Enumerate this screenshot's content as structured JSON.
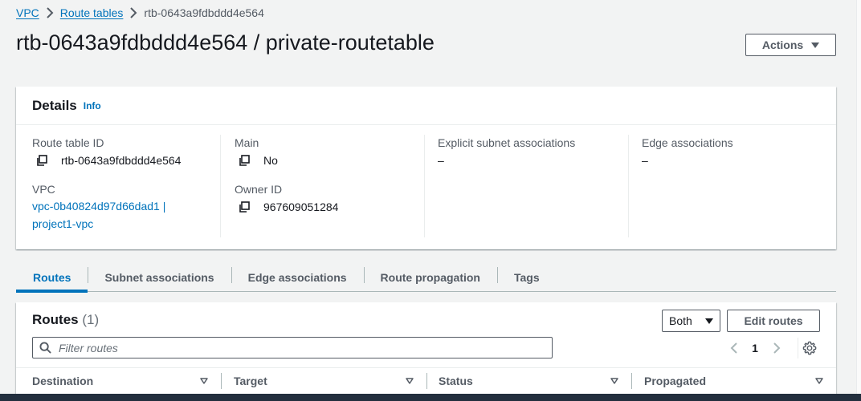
{
  "breadcrumb": {
    "items": [
      "VPC",
      "Route tables"
    ],
    "current": "rtb-0643a9fdbddd4e564"
  },
  "page": {
    "title": "rtb-0643a9fdbddd4e564 / private-routetable",
    "actions_label": "Actions"
  },
  "details": {
    "title": "Details",
    "info_label": "Info",
    "route_table_id_label": "Route table ID",
    "route_table_id_value": "rtb-0643a9fdbddd4e564",
    "vpc_label": "VPC",
    "vpc_value_line1": "vpc-0b40824d97d66dad1 |",
    "vpc_value_line2": "project1-vpc",
    "main_label": "Main",
    "main_value": "No",
    "owner_id_label": "Owner ID",
    "owner_id_value": "967609051284",
    "explicit_subnet_label": "Explicit subnet associations",
    "explicit_subnet_value": "–",
    "edge_assoc_label": "Edge associations",
    "edge_assoc_value": "–"
  },
  "tabs": [
    "Routes",
    "Subnet associations",
    "Edge associations",
    "Route propagation",
    "Tags"
  ],
  "routes": {
    "title": "Routes",
    "count": "(1)",
    "filter_select_value": "Both",
    "edit_label": "Edit routes",
    "filter_placeholder": "Filter routes",
    "page_number": "1",
    "columns": [
      "Destination",
      "Target",
      "Status",
      "Propagated"
    ]
  },
  "colors": {
    "link": "#0073bb",
    "text": "#16191f",
    "muted": "#545b64",
    "background": "#f2f3f3"
  }
}
